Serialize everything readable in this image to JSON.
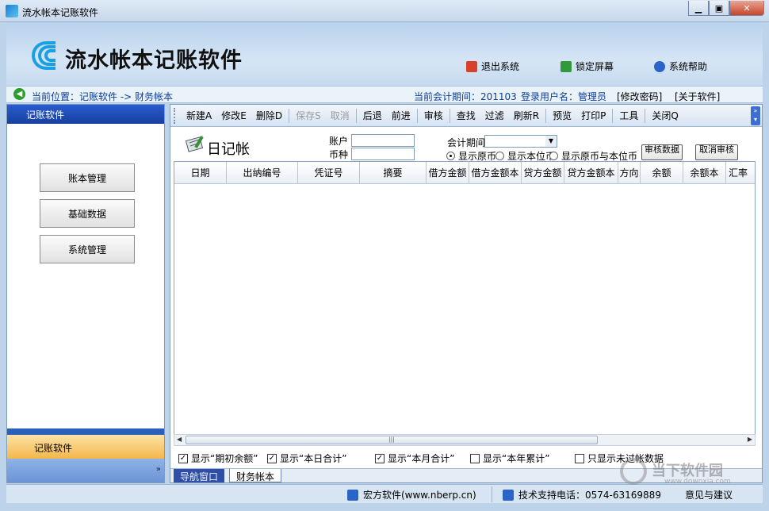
{
  "window": {
    "title": "流水帐本记账软件"
  },
  "header": {
    "app_name": "流水帐本记账软件",
    "buttons": {
      "exit": "退出系统",
      "lock": "锁定屏幕",
      "help": "系统帮助"
    }
  },
  "location": {
    "path": "当前位置：记账软件 -> 财务帐本",
    "period_label": "当前会计期间：201103",
    "user_label": "登录用户名：管理员",
    "change_pwd": "[修改密码]",
    "about": "[关于软件]"
  },
  "sidebar": {
    "header": "记账软件",
    "buttons": [
      "账本管理",
      "基础数据",
      "系统管理"
    ],
    "footer": "记账软件",
    "more": "»"
  },
  "toolbar": {
    "items": [
      {
        "label": "新建A",
        "disabled": false
      },
      {
        "label": "修改E",
        "disabled": false
      },
      {
        "label": "删除D",
        "disabled": false
      },
      {
        "label": "保存S",
        "disabled": true
      },
      {
        "label": "取消",
        "disabled": true
      },
      {
        "label": "后退",
        "disabled": false
      },
      {
        "label": "前进",
        "disabled": false
      },
      {
        "label": "审核",
        "disabled": false
      },
      {
        "label": "查找",
        "disabled": false
      },
      {
        "label": "过滤",
        "disabled": false
      },
      {
        "label": "刷新R",
        "disabled": false
      },
      {
        "label": "预览",
        "disabled": false
      },
      {
        "label": "打印P",
        "disabled": false
      },
      {
        "label": "工具",
        "disabled": false
      },
      {
        "label": "关闭Q",
        "disabled": false
      }
    ]
  },
  "form": {
    "title": "日记帐",
    "account_label": "账户",
    "currency_label": "币种",
    "period_label": "会计期间",
    "radios": [
      "显示原币",
      "显示本位币",
      "显示原币与本位币"
    ],
    "radio_selected": 0,
    "btn_review": "审核数据",
    "btn_unreview": "取消审核"
  },
  "grid": {
    "columns": [
      "日期",
      "出纳编号",
      "凭证号",
      "摘要",
      "借方金额",
      "借方金额本",
      "贷方金额",
      "贷方金额本",
      "方向",
      "余额",
      "余额本",
      "汇率"
    ]
  },
  "checks": [
    {
      "label": "显示“期初余额”",
      "checked": true
    },
    {
      "label": "显示“本日合计”",
      "checked": true
    },
    {
      "label": "显示“本月合计”",
      "checked": true
    },
    {
      "label": "显示“本年累计”",
      "checked": false
    },
    {
      "label": "只显示未过帐数据",
      "checked": false
    }
  ],
  "tabs": {
    "nav": "导航窗口",
    "current": "财务帐本"
  },
  "status": {
    "company": "宏方软件(www.nberp.cn)",
    "phone": "技术支持电话：0574-63169889",
    "feedback": "意见与建议"
  },
  "watermark": {
    "name": "当下软件园",
    "url": "www.downxia.com"
  },
  "colors": {
    "accent": "#173f9e",
    "link": "#0d3f9a",
    "footer": "#f4b74c"
  }
}
